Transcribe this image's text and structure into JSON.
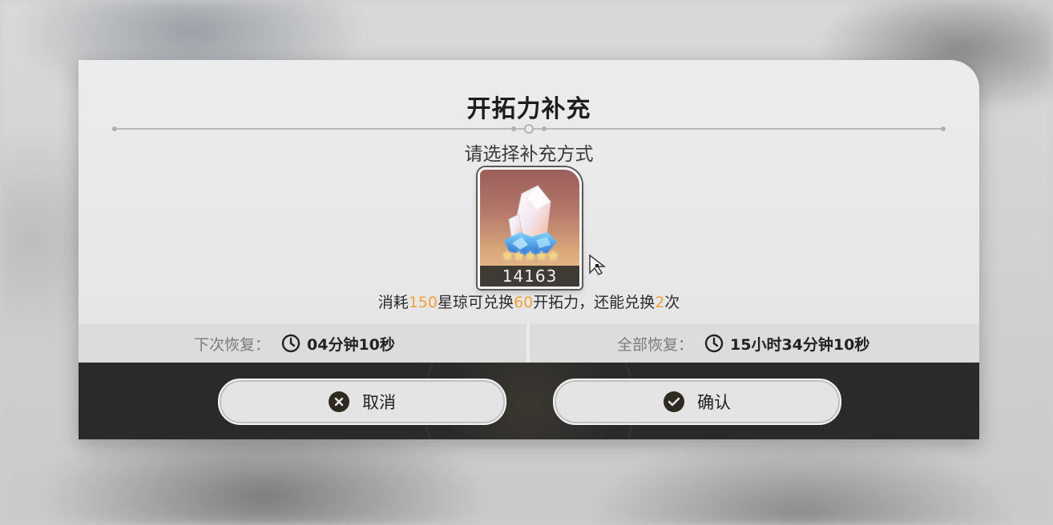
{
  "dialog": {
    "title": "开拓力补充",
    "subtitle": "请选择补充方式"
  },
  "item": {
    "icon": "stellar-jade-icon",
    "rarity_stars": "★★★★★",
    "count": "14163"
  },
  "exchange_info": {
    "prefix": "消耗",
    "cost": "150",
    "middle1": "星琼可兑换",
    "amount": "60",
    "middle2": "开拓力，还能兑换",
    "remaining": "2",
    "suffix": "次"
  },
  "recovery": {
    "next_label": "下次恢复：",
    "next_value": "04分钟10秒",
    "full_label": "全部恢复：",
    "full_value": "15小时34分钟10秒"
  },
  "buttons": {
    "cancel_label": "取消",
    "confirm_label": "确认"
  },
  "colors": {
    "highlight": "#f0a23a",
    "footer": "#2a2a2a",
    "button_bg": "#e4e4e4"
  }
}
